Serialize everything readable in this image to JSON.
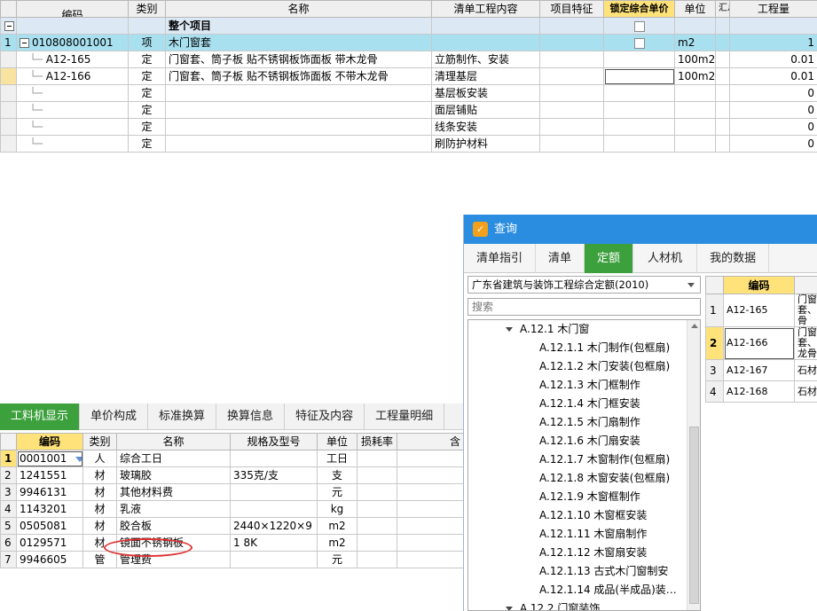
{
  "top_grid": {
    "headers": [
      "编码",
      "类别",
      "名称",
      "清单工程内容",
      "项目特征",
      "锁定综合单价",
      "单位",
      "汇总",
      "工程量"
    ],
    "root_label": "整个项目",
    "rows": [
      {
        "no": "1",
        "code": "010808001001",
        "type": "项",
        "name": "木门窗套",
        "content": "",
        "unit": "m2",
        "qty": "1"
      },
      {
        "no": "",
        "code": "A12-165",
        "type": "定",
        "name": "门窗套、筒子板 贴不锈钢板饰面板 带木龙骨",
        "content": "立筋制作、安装",
        "unit": "100m2",
        "qty": "0.01"
      },
      {
        "no": "",
        "code": "A12-166",
        "type": "定",
        "name": "门窗套、筒子板 贴不锈钢板饰面板 不带木龙骨",
        "content": "清理基层",
        "unit": "100m2",
        "qty": "0.01"
      },
      {
        "no": "",
        "code": "",
        "type": "定",
        "name": "",
        "content": "基层板安装",
        "unit": "",
        "qty": "0"
      },
      {
        "no": "",
        "code": "",
        "type": "定",
        "name": "",
        "content": "面层铺贴",
        "unit": "",
        "qty": "0"
      },
      {
        "no": "",
        "code": "",
        "type": "定",
        "name": "",
        "content": "线条安装",
        "unit": "",
        "qty": "0"
      },
      {
        "no": "",
        "code": "",
        "type": "定",
        "name": "",
        "content": "刷防护材料",
        "unit": "",
        "qty": "0"
      }
    ]
  },
  "bottom_tabs": [
    "工料机显示",
    "单价构成",
    "标准换算",
    "换算信息",
    "特征及内容",
    "工程量明细"
  ],
  "bottom_grid": {
    "headers": [
      "编码",
      "类别",
      "名称",
      "规格及型号",
      "单位",
      "损耗率",
      "含"
    ],
    "rows": [
      {
        "no": "1",
        "code": "0001001",
        "type": "人",
        "name": "综合工日",
        "spec": "",
        "unit": "工日"
      },
      {
        "no": "2",
        "code": "1241551",
        "type": "材",
        "name": "玻璃胶",
        "spec": "335克/支",
        "unit": "支"
      },
      {
        "no": "3",
        "code": "9946131",
        "type": "材",
        "name": "其他材料费",
        "spec": "",
        "unit": "元"
      },
      {
        "no": "4",
        "code": "1143201",
        "type": "材",
        "name": "乳液",
        "spec": "",
        "unit": "kg"
      },
      {
        "no": "5",
        "code": "0505081",
        "type": "材",
        "name": "胶合板",
        "spec": "2440×1220×9",
        "unit": "m2"
      },
      {
        "no": "6",
        "code": "0129571",
        "type": "材",
        "name": "镜面不锈钢板",
        "spec": "1 8K",
        "unit": "m2"
      },
      {
        "no": "7",
        "code": "9946605",
        "type": "管",
        "name": "管理费",
        "spec": "",
        "unit": "元"
      }
    ]
  },
  "query_panel": {
    "title": "查询",
    "tabs": [
      "清单指引",
      "清单",
      "定额",
      "人材机",
      "我的数据"
    ],
    "library": "广东省建筑与装饰工程综合定额(2010)",
    "search_placeholder": "搜索",
    "tree_parent": "A.12.1 木门窗",
    "tree_items": [
      "A.12.1.1 木门制作(包框扇)",
      "A.12.1.2 木门安装(包框扇)",
      "A.12.1.3 木门框制作",
      "A.12.1.4 木门框安装",
      "A.12.1.5 木门扇制作",
      "A.12.1.6 木门扇安装",
      "A.12.1.7 木窗制作(包框扇)",
      "A.12.1.8 木窗安装(包框扇)",
      "A.12.1.9 木窗框制作",
      "A.12.1.10 木窗框安装",
      "A.12.1.11 木窗扇制作",
      "A.12.1.12 木窗扇安装",
      "A.12.1.13 古式木门窗制安",
      "A.12.1.14 成品(半成品)装…"
    ],
    "tree_next": "A.12.2 门窗装饰",
    "grid_header": "编码",
    "grid_rows": [
      {
        "no": "1",
        "code": "A12-165",
        "name": "门窗套、骨"
      },
      {
        "no": "2",
        "code": "A12-166",
        "name": "门窗套、龙骨"
      },
      {
        "no": "3",
        "code": "A12-167",
        "name": "石材门"
      },
      {
        "no": "4",
        "code": "A12-168",
        "name": "石材门"
      }
    ]
  }
}
